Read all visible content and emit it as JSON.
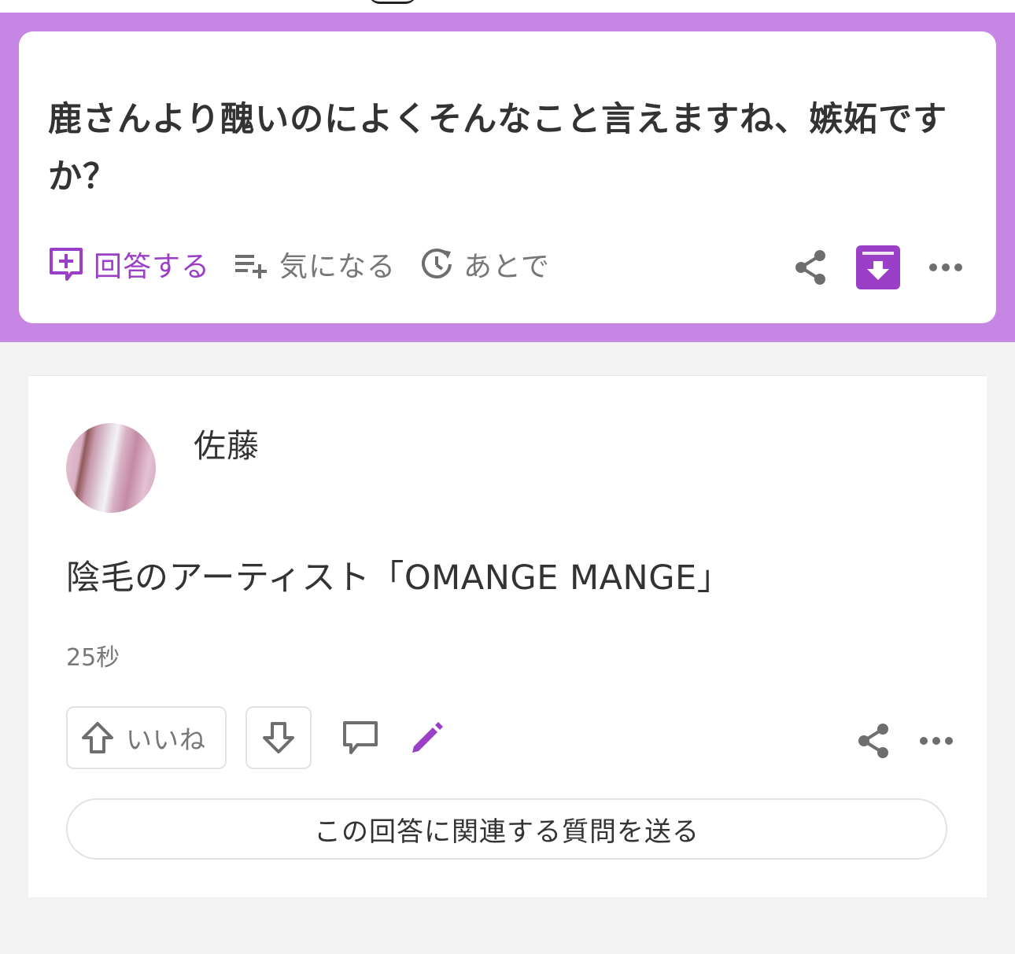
{
  "question": {
    "text": "鹿さんより醜いのによくそんなこと言えますね、嫉妬ですか？",
    "actions": {
      "answer_label": "回答する",
      "follow_label": "気になる",
      "later_label": "あとで"
    }
  },
  "answer": {
    "author": "佐藤",
    "body": "陰毛のアーティスト「OMANGE MANGE」",
    "timestamp": "25秒",
    "upvote_label": "いいね",
    "related_question_label": "この回答に関連する質問を送る"
  },
  "colors": {
    "accent": "#9a3fc6",
    "band": "#c587e3",
    "icon_gray": "#6e6e6e"
  },
  "icons": [
    "answer-plus-icon",
    "follow-list-icon",
    "later-clock-icon",
    "share-icon",
    "archive-icon",
    "more-icon",
    "upvote-arrow-icon",
    "downvote-arrow-icon",
    "comment-icon",
    "edit-pencil-icon"
  ]
}
